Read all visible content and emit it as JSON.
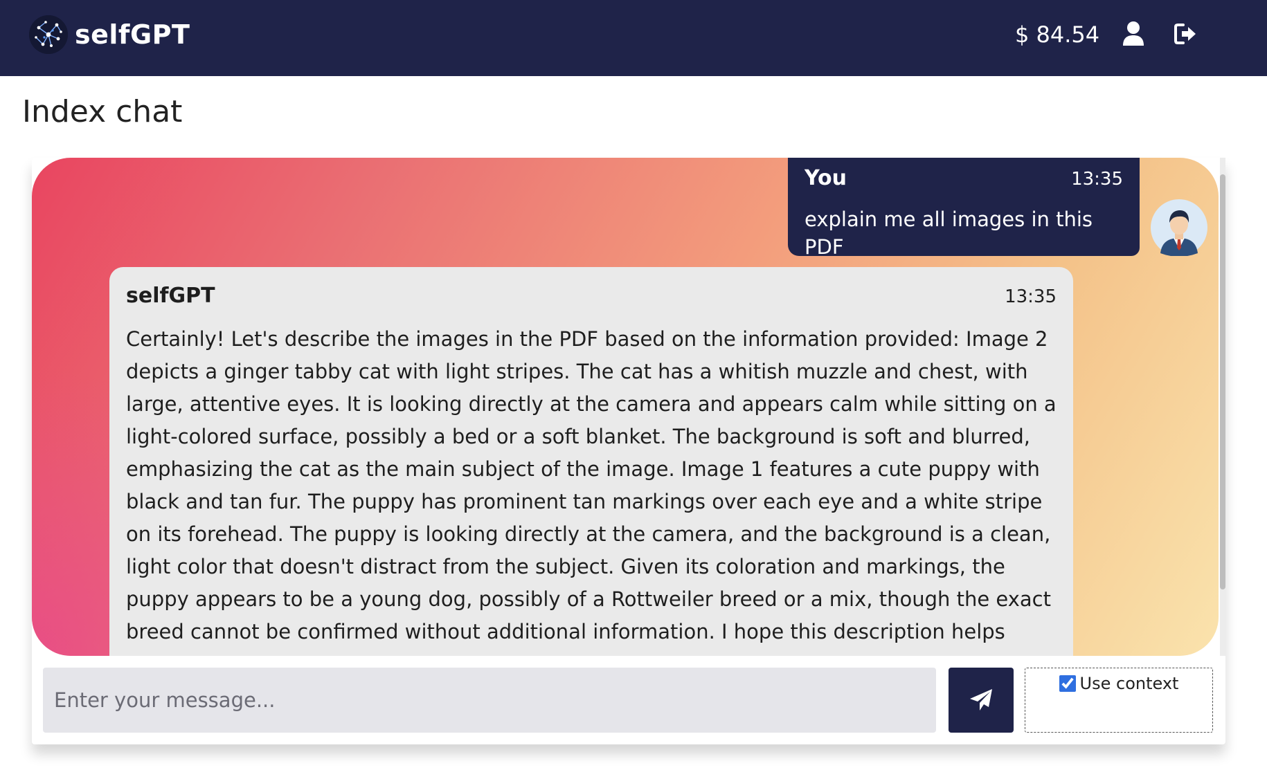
{
  "navbar": {
    "brand_name": "selfGPT",
    "balance": "$ 84.54",
    "icons": [
      "network-logo-icon",
      "user-icon",
      "logout-icon"
    ]
  },
  "page": {
    "title": "Index chat"
  },
  "chat": {
    "messages": [
      {
        "sender": "You",
        "time": "13:35",
        "text": "explain me all images in this PDF"
      },
      {
        "sender": "selfGPT",
        "time": "13:35",
        "text": "Certainly! Let's describe the images in the PDF based on the information provided: Image 2\ndepicts a ginger tabby cat with light stripes. The cat has a whitish muzzle and chest, with\nlarge, attentive eyes. It is looking directly at the camera and appears calm while sitting on a\nlight-colored surface, possibly a bed or a soft blanket. The background is soft and blurred,\nemphasizing the cat as the main subject of the image. Image 1 features a cute puppy with\nblack and tan fur. The puppy has prominent tan markings over each eye and a white stripe\non its forehead. The puppy is looking directly at the camera, and the background is a clean,\nlight color that doesn't distract from the subject. Given its coloration and markings, the\npuppy appears to be a young dog, possibly of a Rottweiler breed or a mix, though the exact\nbreed cannot be confirmed without additional information. I hope this description helps"
      }
    ]
  },
  "composer": {
    "placeholder": "Enter your message...",
    "value": "",
    "use_context_label": "Use context",
    "use_context_checked": true
  },
  "colors": {
    "navbar_bg": "#1f2349",
    "user_bubble_bg": "#1f2349",
    "bot_bubble_bg": "#eaeaea",
    "gradient_start": "#e94560",
    "gradient_end": "#fae3ad",
    "checkbox_accent": "#2f6fe0"
  }
}
